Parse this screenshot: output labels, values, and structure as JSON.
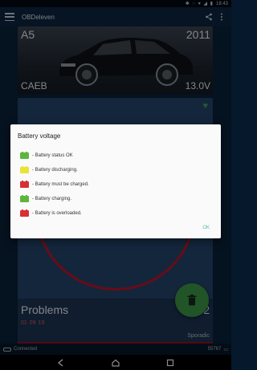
{
  "status_bar": {
    "icons": [
      "bluetooth-icon",
      "vibrate-icon",
      "wifi-icon",
      "signal-icon",
      "battery-icon"
    ],
    "time": "18:43"
  },
  "toolbar": {
    "title": "OBDeleven",
    "icons": [
      "menu-icon",
      "share-icon",
      "overflow-icon"
    ]
  },
  "car": {
    "model": "A5",
    "year": "2011",
    "engine": "CAEB",
    "voltage": "13.0V"
  },
  "problems": {
    "title": "Problems",
    "count": "42",
    "codes": [
      "01",
      "09",
      "19"
    ],
    "type": "Sporadic"
  },
  "footer": {
    "status": "Connected",
    "number": "55767"
  },
  "dialog": {
    "title": "Battery voltage",
    "items": [
      {
        "color": "#5db63c",
        "label": "- Battery status OK"
      },
      {
        "color": "#e8e337",
        "label": "- Battery discharging."
      },
      {
        "color": "#d63034",
        "label": "- Battery must be charged."
      },
      {
        "color": "#5db63c",
        "label": "- Battery charging."
      },
      {
        "color": "#d63034",
        "label": "- Battery is overloaded."
      }
    ],
    "ok_label": "OK"
  },
  "colors": {
    "accent_green": "#3d9a47",
    "ring_red": "#c0152a",
    "card_blue": "#26466d",
    "ok_teal": "#5bb5a6"
  }
}
